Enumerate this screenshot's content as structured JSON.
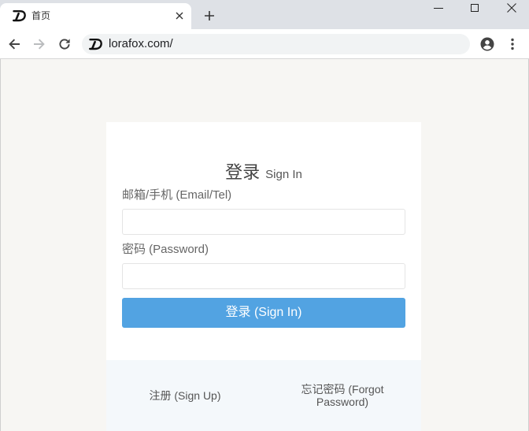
{
  "browser": {
    "tab": {
      "title": "首页",
      "favicon": "lorafox-logo-icon",
      "close_icon": "close-icon"
    },
    "new_tab_icon": "plus-icon",
    "window_controls": [
      "minimize-icon",
      "maximize-icon",
      "window-close-icon"
    ],
    "nav_icons": [
      "back-arrow-icon",
      "forward-arrow-icon",
      "reload-icon"
    ],
    "forward_disabled": true,
    "address_bar": {
      "url": "lorafox.com/",
      "site_icon": "lorafox-logo-icon"
    },
    "toolbar_icons": [
      "account-icon",
      "menu-dots-icon"
    ]
  },
  "login_form": {
    "title_zh": "登录",
    "title_en": "Sign In",
    "email": {
      "label": "邮箱/手机 (Email/Tel)",
      "value": "",
      "placeholder": ""
    },
    "password": {
      "label": "密码 (Password)",
      "value": "",
      "placeholder": ""
    },
    "submit_label": "登录 (Sign In)"
  },
  "footer_links": {
    "sign_up": "注册 (Sign Up)",
    "forgot_password": "忘记密码 (Forgot Password)"
  },
  "colors": {
    "tab_strip": "#dee1e6",
    "page_background": "#f7f6f3",
    "primary_button": "#52a3e2",
    "card_footer": "#f4f8fb",
    "label_text": "#666666"
  }
}
